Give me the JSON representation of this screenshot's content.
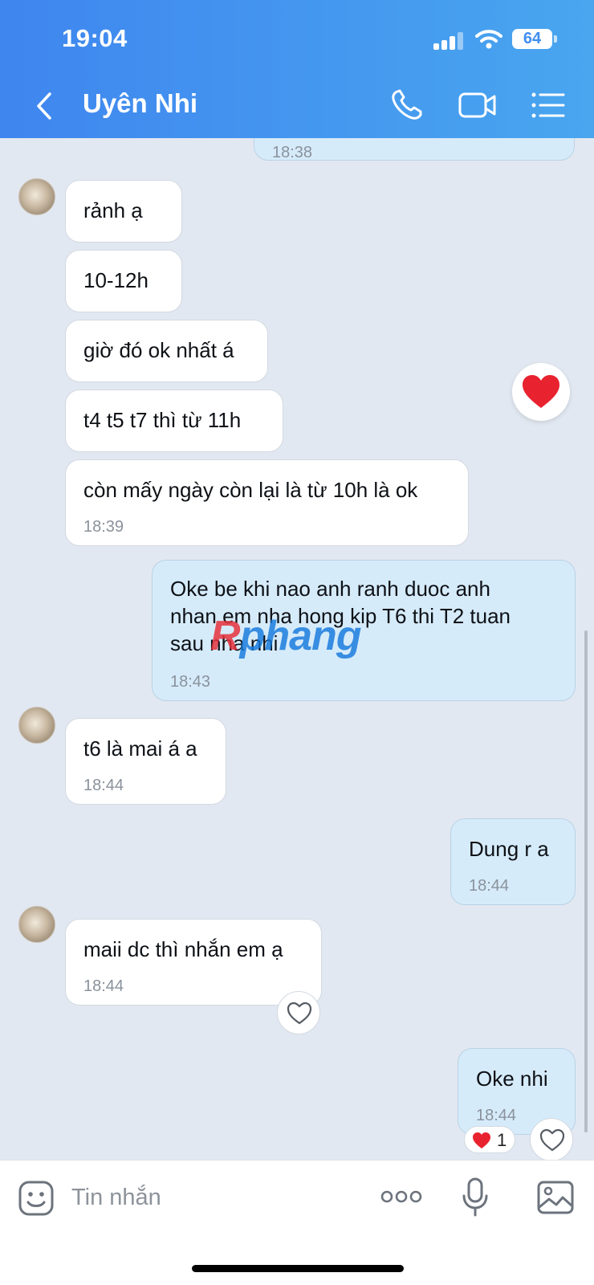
{
  "status_bar": {
    "time": "19:04",
    "battery": "64"
  },
  "header": {
    "title": "Uyên Nhi"
  },
  "messages": {
    "m0_ts": "18:38",
    "m1": "rảnh ạ",
    "m2": "10-12h",
    "m3": "giờ đó ok nhất á",
    "m4": "t4 t5 t7 thì từ 11h",
    "m5": "còn mấy ngày còn lại là từ 10h là ok",
    "m5_ts": "18:39",
    "m6_line1": "Oke be khi nao anh ranh duoc anh",
    "m6_line2": "nhan em nha hong kip T6 thi T2 tuan",
    "m6_line3": "sau nha nhi",
    "m6_ts": "18:43",
    "m7": "t6 là mai á a",
    "m7_ts": "18:44",
    "m8": "Dung r a",
    "m8_ts": "18:44",
    "m9": "maii dc thì nhắn em ạ",
    "m9_ts": "18:44",
    "m10": "Oke nhi",
    "m10_ts": "18:44"
  },
  "reactions": {
    "heart_count": "1"
  },
  "watermark": {
    "red": "R",
    "rest": "phang"
  },
  "input": {
    "placeholder": "Tin nhắn"
  },
  "colors": {
    "header_start": "#3f86ef",
    "header_end": "#49a6ef",
    "outgoing_bubble": "#d6ebfa",
    "heart": "#e8232f"
  },
  "icons": [
    "back-icon",
    "phone-icon",
    "video-call-icon",
    "menu-list-icon",
    "heart-icon",
    "sticker-icon",
    "more-icon",
    "microphone-icon",
    "image-icon"
  ]
}
